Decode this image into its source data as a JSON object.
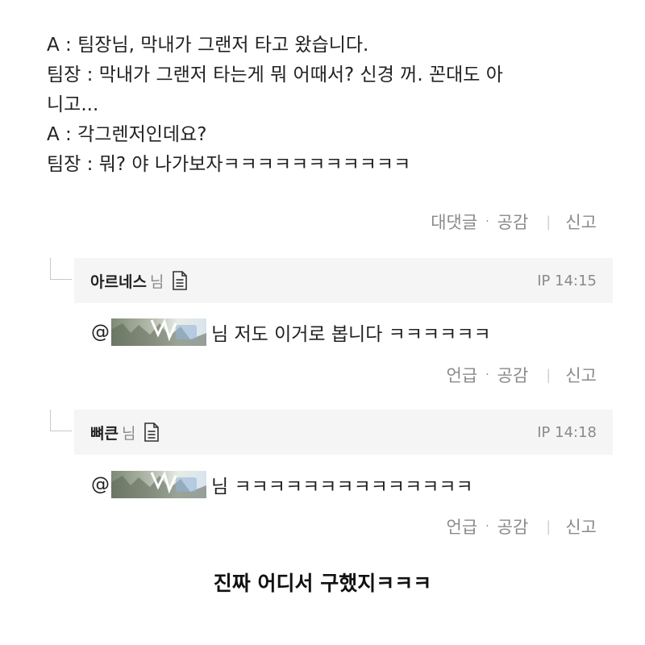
{
  "post": {
    "lines": [
      "A : 팀장님, 막내가 그랜저 타고 왔습니다.",
      "팀장 : 막내가 그랜저 타는게 뭐 어때서? 신경 꺼. 꼰대도 아",
      "니고...",
      "A : 각그렌저인데요?",
      "팀장 : 뭐? 야 나가보자ㅋㅋㅋㅋㅋㅋㅋㅋㅋㅋㅋ"
    ],
    "actions": {
      "reply": "대댓글",
      "like": "공감",
      "report": "신고"
    }
  },
  "replies": [
    {
      "nickname": "아르네스",
      "suffix": "님",
      "ip_time": "IP 14:15",
      "at": "@",
      "text": "님 저도 이거로 봅니다 ㅋㅋㅋㅋㅋㅋ",
      "actions": {
        "mention": "언급",
        "like": "공감",
        "report": "신고"
      }
    },
    {
      "nickname": "뼈큰",
      "suffix": "님",
      "ip_time": "IP 14:18",
      "at": "@",
      "text": "님 ㅋㅋㅋㅋㅋㅋㅋㅋㅋㅋㅋㅋㅋㅋ",
      "actions": {
        "mention": "언급",
        "like": "공감",
        "report": "신고"
      }
    }
  ],
  "caption": "진짜 어디서 구했지ㅋㅋㅋ",
  "colors": {
    "text": "#222222",
    "muted": "#8a8a8a",
    "reply_bg": "#f5f5f5"
  },
  "icons": [
    "document-icon",
    "reply-arrow-icon"
  ]
}
